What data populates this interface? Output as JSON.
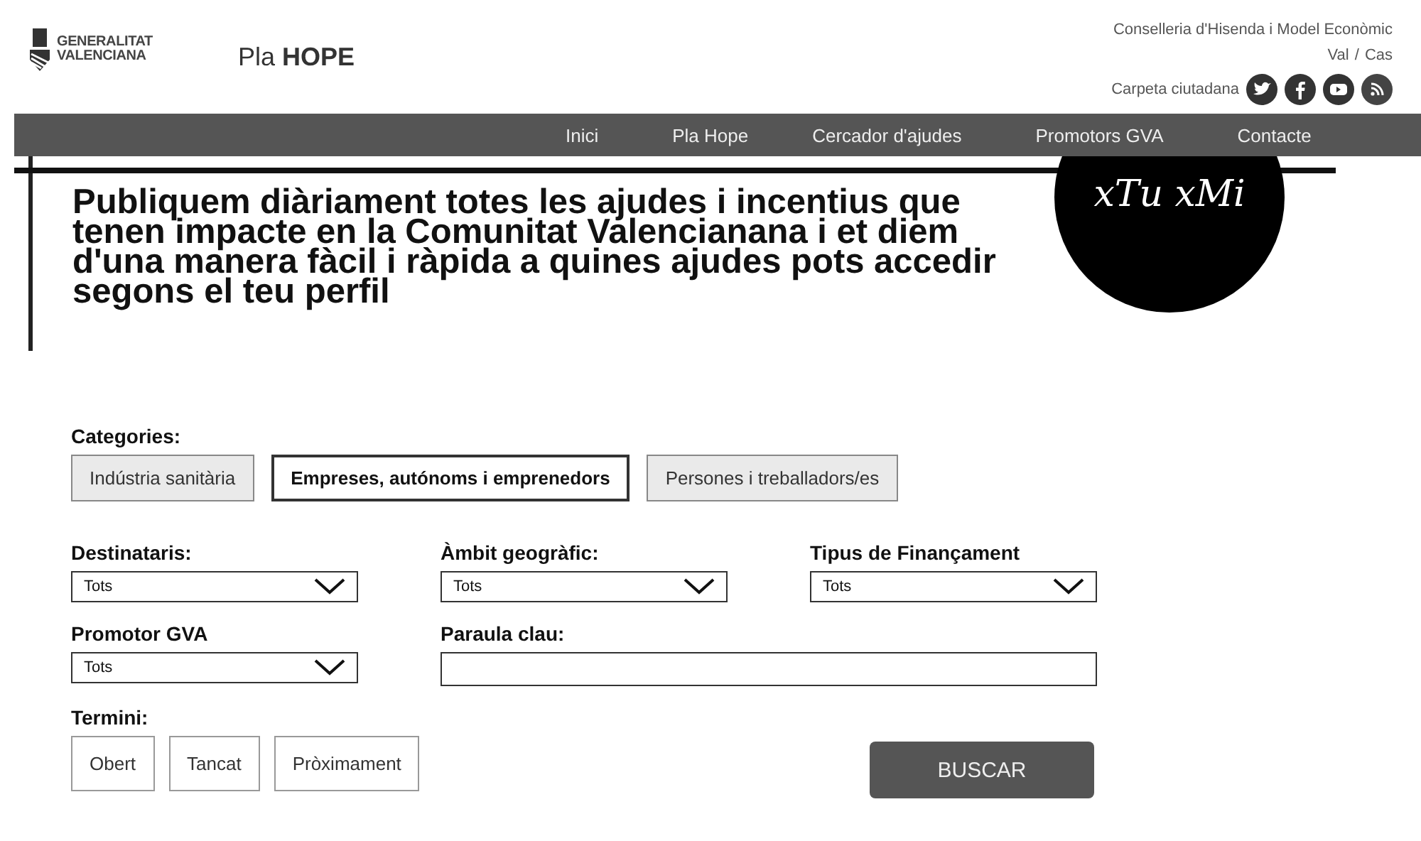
{
  "header": {
    "logo_lines": [
      "GENERALITAT",
      "VALENCIANA"
    ],
    "site_prefix": "Pla",
    "site_name": "HOPE",
    "department": "Conselleria d'Hisenda i Model Econòmic",
    "languages": [
      {
        "label": "Val",
        "selected": false
      },
      {
        "label": "Cas",
        "selected": false
      }
    ],
    "language_separator": "/",
    "citizen_folder": "Carpeta ciutadana",
    "social": [
      {
        "kind": "twitter"
      },
      {
        "kind": "facebook"
      },
      {
        "kind": "youtube"
      },
      {
        "kind": "rss"
      }
    ]
  },
  "nav": [
    {
      "label": "Inici"
    },
    {
      "label": "Pla Hope"
    },
    {
      "label": "Cercador d'ajudes"
    },
    {
      "label": "Promotors GVA"
    },
    {
      "label": "Contacte"
    }
  ],
  "badge": "xTu xMi",
  "headline": "Publiquem diàriament totes les ajudes i incentius que tenen impacte en la Comunitat Valencianana i et diem d'una manera fàcil i ràpida a quines ajudes pots accedir segons el teu perfil",
  "categories": {
    "label": "Categories:",
    "options": [
      {
        "label": "Indústria sanitària",
        "selected": false
      },
      {
        "label": "Empreses, autónoms i emprenedors",
        "selected": true
      },
      {
        "label": "Persones i treballadors/es",
        "selected": false
      }
    ]
  },
  "filters": [
    {
      "label": "Destinataris:",
      "kind": "select",
      "value": "Tots"
    },
    {
      "label": "Àmbit geogràfic:",
      "kind": "select",
      "value": "Tots"
    },
    {
      "label": "Tipus de Finançament",
      "kind": "select",
      "value": "Tots"
    },
    {
      "label": "Promotor GVA",
      "kind": "select",
      "value": "Tots"
    },
    {
      "label": "Paraula clau:",
      "kind": "text"
    }
  ],
  "term": {
    "label": "Termini:",
    "options": [
      {
        "label": "Obert",
        "selected": false
      },
      {
        "label": "Tancat",
        "selected": false
      },
      {
        "label": "Pròximament",
        "selected": false
      }
    ]
  },
  "search_button": "BUSCAR"
}
